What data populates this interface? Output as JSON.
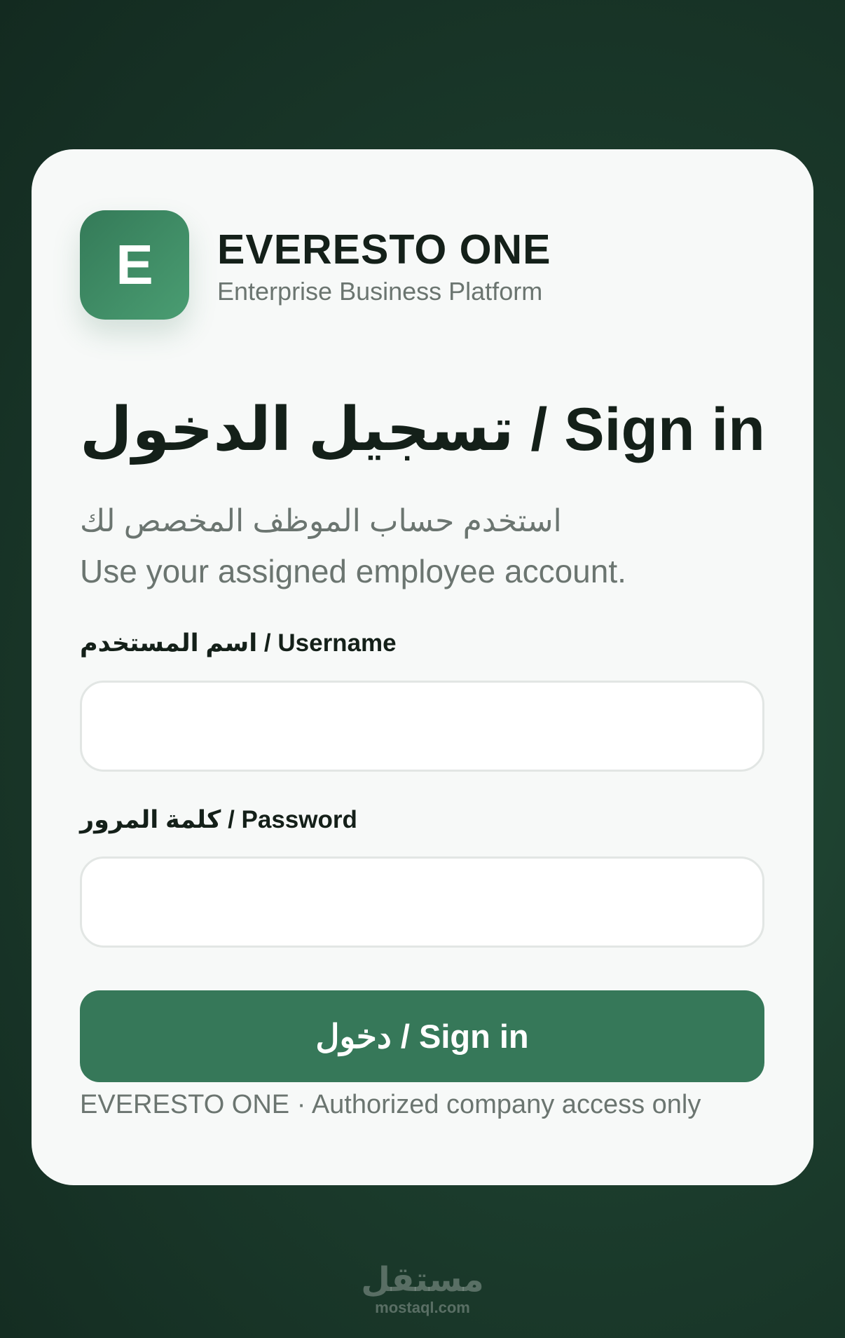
{
  "brand": {
    "logo_letter": "E",
    "name": "EVERESTO ONE",
    "tagline": "Enterprise Business Platform"
  },
  "login": {
    "title": "تسجيل الدخول / Sign in",
    "subtitle_ar": "استخدم حساب الموظف المخصص لك",
    "subtitle_en": "Use your assigned employee account.",
    "username_label": "اسم المستخدم / Username",
    "username_value": "",
    "password_label": "كلمة المرور / Password",
    "password_value": "",
    "submit_label": "دخول / Sign in",
    "footer": "EVERESTO ONE · Authorized company access only"
  },
  "watermark": {
    "arabic": "مستقل",
    "latin": "mostaql.com"
  },
  "colors": {
    "background": "#1c3d2d",
    "card": "#f7f9f8",
    "accent": "#367859",
    "text": "#142019",
    "muted": "#6b7570"
  }
}
